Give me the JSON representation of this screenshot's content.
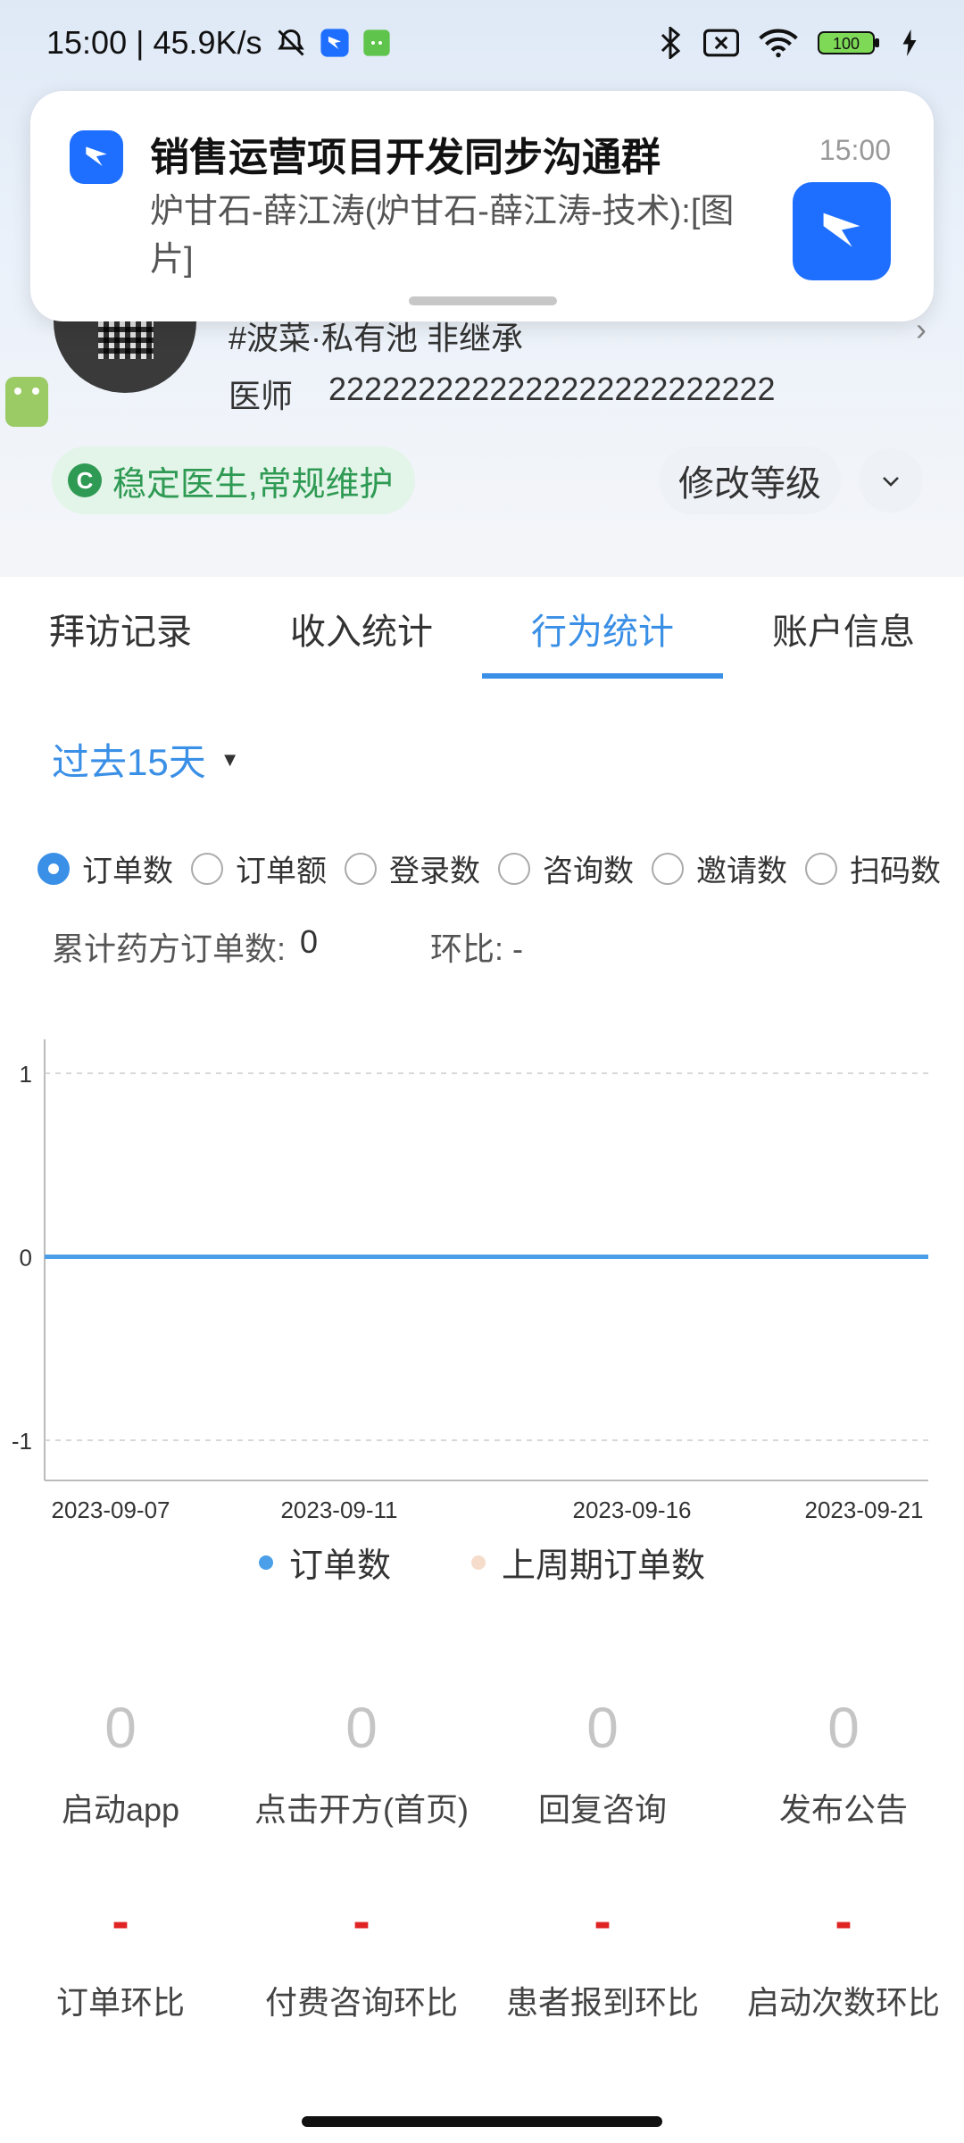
{
  "status_bar": {
    "time_speed": "15:00 | 45.9K/s",
    "battery": "100"
  },
  "notification": {
    "title": "销售运营项目开发同步沟通群",
    "time": "15:00",
    "body": "炉甘石-薛江涛(炉甘石-薛江涛-技术):[图片]"
  },
  "profile": {
    "tag_line": "#波菜·私有池 非继承",
    "role": "医师",
    "phone": "2222222222222222222222222",
    "status_chip": "稳定医生,常规维护",
    "status_chip_icon_letter": "C",
    "edit_level": "修改等级"
  },
  "tabs": [
    {
      "label": "拜访记录"
    },
    {
      "label": "收入统计"
    },
    {
      "label": "行为统计"
    },
    {
      "label": "账户信息"
    }
  ],
  "period": {
    "label": "过去15天"
  },
  "radios": [
    {
      "label": "订单数",
      "checked": true
    },
    {
      "label": "订单额"
    },
    {
      "label": "登录数"
    },
    {
      "label": "咨询数"
    },
    {
      "label": "邀请数"
    },
    {
      "label": "扫码数"
    }
  ],
  "cumulative": {
    "label": "累计药方订单数:",
    "value": "0",
    "ratio_label": "环比: -"
  },
  "chart_data": {
    "type": "line",
    "x_ticks": [
      "2023-09-07",
      "2023-09-11",
      "2023-09-16",
      "2023-09-21"
    ],
    "y_ticks": [
      "1",
      "0",
      "-1"
    ],
    "ylim": [
      -1,
      1
    ],
    "series": [
      {
        "name": "订单数",
        "color": "#4a9fe8",
        "values": [
          0,
          0
        ]
      },
      {
        "name": "上周期订单数",
        "color": "#f6dccb",
        "values": []
      }
    ],
    "grid": true,
    "legend": "bottom"
  },
  "stats": [
    {
      "value": "0",
      "label": "启动app"
    },
    {
      "value": "0",
      "label": "点击开方(首页)"
    },
    {
      "value": "0",
      "label": "回复咨询"
    },
    {
      "value": "0",
      "label": "发布公告"
    }
  ],
  "ratios": [
    {
      "value": "-",
      "label": "订单环比"
    },
    {
      "value": "-",
      "label": "付费咨询环比"
    },
    {
      "value": "-",
      "label": "患者报到环比"
    },
    {
      "value": "-",
      "label": "启动次数环比"
    }
  ]
}
